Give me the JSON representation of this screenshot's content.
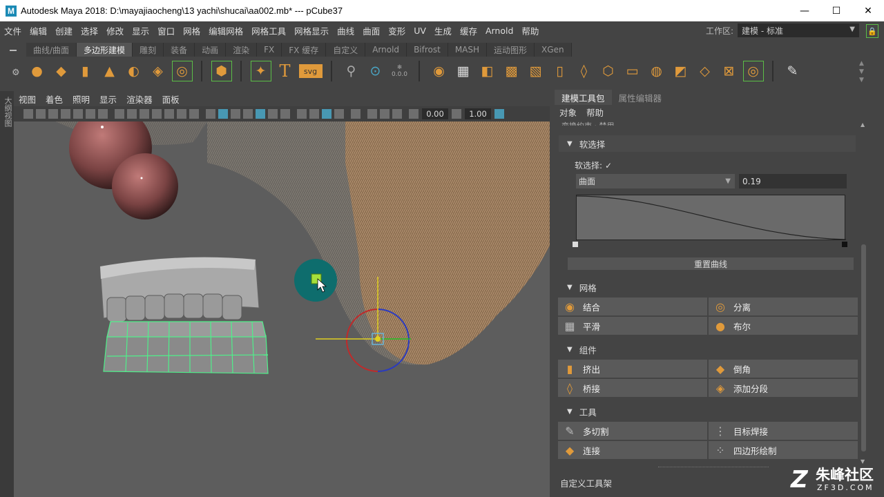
{
  "window": {
    "app_letter": "M",
    "title": "Autodesk Maya 2018: D:\\mayajiaocheng\\13 yachi\\shucai\\aa002.mb*   ---   pCube37",
    "minimize": "—",
    "maximize": "☐",
    "close": "✕"
  },
  "menubar": [
    "文件",
    "编辑",
    "创建",
    "选择",
    "修改",
    "显示",
    "窗口",
    "网格",
    "编辑网格",
    "网格工具",
    "网格显示",
    "曲线",
    "曲面",
    "变形",
    "UV",
    "生成",
    "缓存",
    "Arnold",
    "帮助"
  ],
  "workspace": {
    "label": "工作区:",
    "value": "建模 - 标准"
  },
  "shelf_tabs": [
    {
      "label": "曲线/曲面",
      "active": false
    },
    {
      "label": "多边形建模",
      "active": true
    },
    {
      "label": "雕刻",
      "active": false
    },
    {
      "label": "装备",
      "active": false
    },
    {
      "label": "动画",
      "active": false
    },
    {
      "label": "渲染",
      "active": false
    },
    {
      "label": "FX",
      "active": false
    },
    {
      "label": "FX 缓存",
      "active": false
    },
    {
      "label": "自定义",
      "active": false
    },
    {
      "label": "Arnold",
      "active": false
    },
    {
      "label": "Bifrost",
      "active": false
    },
    {
      "label": "MASH",
      "active": false
    },
    {
      "label": "运动图形",
      "active": false
    },
    {
      "label": "XGen",
      "active": false
    }
  ],
  "shelf_text_icons": {
    "text_tool": "T",
    "svg_tool": "svg",
    "counter": "0.0.0"
  },
  "left_strip_label": "大纲视图",
  "viewport_menu": [
    "视图",
    "着色",
    "照明",
    "显示",
    "渲染器",
    "面板"
  ],
  "viewport_fields": {
    "field_a": "0.00",
    "field_b": "1.00"
  },
  "panel": {
    "tabs": [
      {
        "label": "建模工具包",
        "active": true
      },
      {
        "label": "属性编辑器",
        "active": false
      }
    ],
    "submenu": [
      "对象",
      "帮助"
    ],
    "cut_header": "变换约束 · 禁用",
    "soft_select": {
      "header": "软选择",
      "checkbox_label": "软选择:",
      "checked": "✓",
      "falloff_mode": "曲面",
      "falloff_value": "0.19",
      "reset_label": "重置曲线"
    },
    "mesh": {
      "header": "网格",
      "buttons": [
        {
          "label": "结合",
          "icon": "combine-icon"
        },
        {
          "label": "分离",
          "icon": "separate-icon"
        },
        {
          "label": "平滑",
          "icon": "smooth-icon"
        },
        {
          "label": "布尔",
          "icon": "boolean-icon"
        }
      ]
    },
    "components": {
      "header": "组件",
      "buttons": [
        {
          "label": "挤出",
          "icon": "extrude-icon"
        },
        {
          "label": "倒角",
          "icon": "bevel-icon"
        },
        {
          "label": "桥接",
          "icon": "bridge-icon"
        },
        {
          "label": "添加分段",
          "icon": "add-divisions-icon"
        }
      ]
    },
    "tools": {
      "header": "工具",
      "buttons": [
        {
          "label": "多切割",
          "icon": "multi-cut-icon"
        },
        {
          "label": "目标焊接",
          "icon": "target-weld-icon"
        },
        {
          "label": "连接",
          "icon": "connect-icon"
        },
        {
          "label": "四边形绘制",
          "icon": "quad-draw-icon"
        }
      ]
    },
    "custom_shelf": "自定义工具架"
  },
  "watermark": {
    "brand": "朱峰社区",
    "url": "ZF3D.COM",
    "logo": "Z"
  },
  "colors": {
    "accent_orange": "#e09a3b",
    "highlight_green": "#5bbf47",
    "selection_blue": "#4aa8c8"
  }
}
